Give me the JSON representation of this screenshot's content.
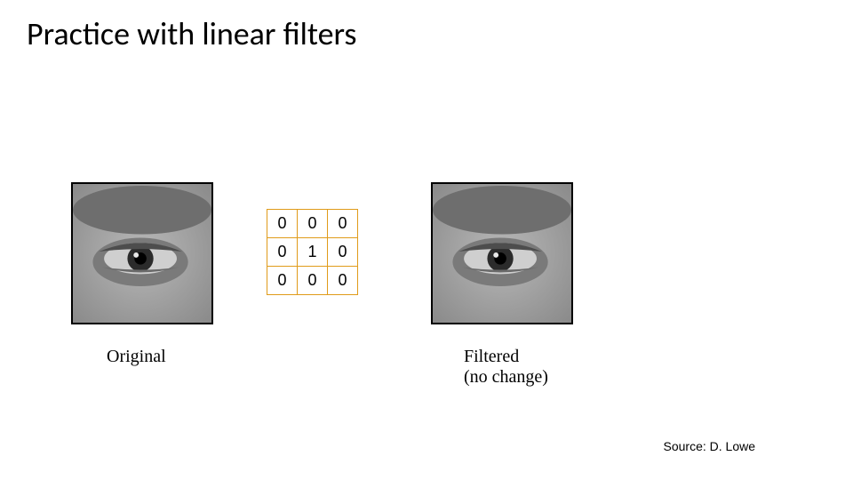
{
  "title": "Practice with linear filters",
  "kernel": {
    "r0c0": "0",
    "r0c1": "0",
    "r0c2": "0",
    "r1c0": "0",
    "r1c1": "1",
    "r1c2": "0",
    "r2c0": "0",
    "r2c1": "0",
    "r2c2": "0"
  },
  "captions": {
    "original": "Original",
    "filtered_line1": "Filtered",
    "filtered_line2": "(no change)"
  },
  "source": "Source: D. Lowe",
  "images": {
    "left_alt": "eye-original",
    "right_alt": "eye-filtered"
  }
}
